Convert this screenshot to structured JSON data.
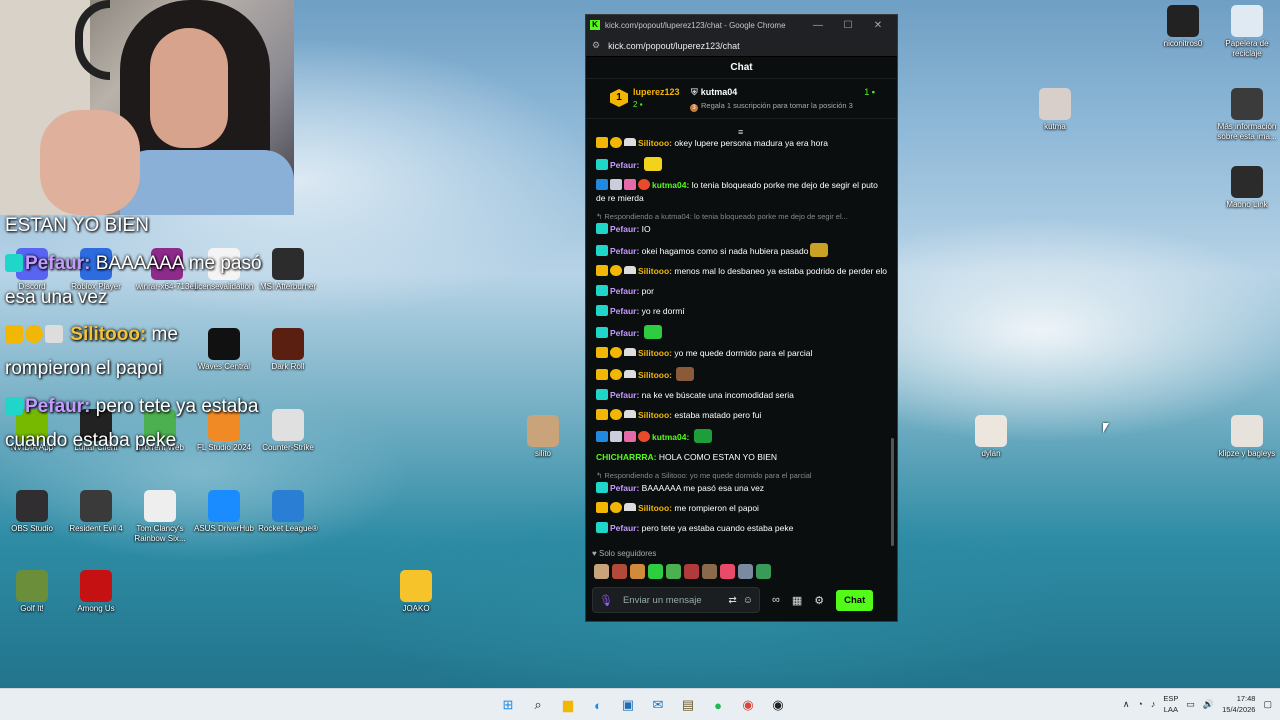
{
  "overlay": {
    "status": "ESTAN YO BIEN",
    "line1_user": "Pefaur:",
    "line1_text": "BAAAAAA me pasó",
    "line1_cont": "esa una vez",
    "line2_user": "Silitooo:",
    "line2_text": "me",
    "line2_cont": "rompieron el papoi",
    "line3_user": "Pefaur:",
    "line3_text": "pero tete ya estaba",
    "line3_cont": "cuando estaba peke"
  },
  "desktop_icons": [
    {
      "label": "Discord",
      "color": "#5865f2",
      "icon": "discord-icon"
    },
    {
      "label": "Roblox Player",
      "color": "#2d6cdf",
      "icon": "roblox-icon"
    },
    {
      "label": "winrar-x64-713es",
      "color": "#8e2a8a",
      "icon": "winrar-icon"
    },
    {
      "label": "licensevalidation",
      "color": "#f4f4f4",
      "icon": "file-icon"
    },
    {
      "label": "MSI Afterburner",
      "color": "#2c2c2c",
      "icon": "afterburner-icon"
    },
    {
      "label": "Waves Central",
      "color": "#111111",
      "icon": "waves-icon"
    },
    {
      "label": "Dark Roll",
      "color": "#5a1f10",
      "icon": "darkroll-icon"
    },
    {
      "label": "NVIDIA App",
      "color": "#76b900",
      "icon": "nvidia-icon"
    },
    {
      "label": "Lunar Client",
      "color": "#222222",
      "icon": "lunar-icon"
    },
    {
      "label": "uTorrent Web",
      "color": "#4caf50",
      "icon": "utorrent-icon"
    },
    {
      "label": "FL Studio 2024",
      "color": "#f08a24",
      "icon": "flstudio-icon"
    },
    {
      "label": "Counter-Strike",
      "color": "#e0e0e0",
      "icon": "counterstrike-icon"
    },
    {
      "label": "OBS Studio",
      "color": "#302e31",
      "icon": "obs-icon"
    },
    {
      "label": "Resident Evil 4",
      "color": "#3a3a3a",
      "icon": "re4-icon"
    },
    {
      "label": "Tom Clancy's Rainbow Six...",
      "color": "#eeeeee",
      "icon": "r6-icon"
    },
    {
      "label": "ASUS DriverHub",
      "color": "#1a8cff",
      "icon": "asus-icon"
    },
    {
      "label": "Rocket League®",
      "color": "#2a7fd4",
      "icon": "rocketleague-icon"
    },
    {
      "label": "Golf It!",
      "color": "#6b8e3a",
      "icon": "golfit-icon"
    },
    {
      "label": "Among Us",
      "color": "#c51111",
      "icon": "amongus-icon"
    },
    {
      "label": "JOAKO",
      "color": "#f6c32a",
      "icon": "joako-icon"
    },
    {
      "label": "silito",
      "color": "#c9a37a",
      "icon": "silito-icon"
    },
    {
      "label": "niconitros0",
      "color": "#222222",
      "icon": "niconitros-icon"
    },
    {
      "label": "Papelera de reciclaje",
      "color": "#dfeaf3",
      "icon": "recycle-bin-icon"
    },
    {
      "label": "kutma",
      "color": "#d8cfcb",
      "icon": "kutma-icon"
    },
    {
      "label": "Más información sobre esta ima...",
      "color": "#3b3b3b",
      "icon": "info-icon"
    },
    {
      "label": "Maono Link",
      "color": "#2b2b2b",
      "icon": "maono-icon"
    },
    {
      "label": "dylan",
      "color": "#ece6df",
      "icon": "dylan-icon"
    },
    {
      "label": "klipze y bagleys",
      "color": "#e7e2dc",
      "icon": "klipze-icon"
    }
  ],
  "window": {
    "title": "kick.com/popout/luperez123/chat - Google Chrome",
    "url": "kick.com/popout/luperez123/chat",
    "minimize": "—",
    "maximize": "☐",
    "close": "✕"
  },
  "chat": {
    "header": "Chat",
    "leaderboard": {
      "rank1": "1",
      "user1": "luperez123",
      "count1": "2",
      "user2": "kutma04",
      "count2": "1",
      "gift_rank": "3",
      "gift_text": "Regala 1 suscripción para tomar la posición 3"
    },
    "messages": [
      {
        "user": "Silitooo:",
        "color": "#f2b705",
        "badges": [
          "crown",
          "sub",
          "hat"
        ],
        "text": "okey lupere persona madura ya era hora"
      },
      {
        "user": "Pefaur:",
        "color": "#c59bff",
        "badges": [
          "kick"
        ],
        "text": "",
        "emote": "#f2d21b"
      },
      {
        "user": "kutma04:",
        "color": "#53fc18",
        "badges": [
          "blue",
          "white",
          "pink",
          "red"
        ],
        "text": "lo tenia bloqueado porke me dejo de segir el puto de re mierda"
      },
      {
        "reply": "Respondiendo a kutma04: lo tenia bloqueado porke me dejo de segir el...",
        "user": "Pefaur:",
        "color": "#c59bff",
        "badges": [
          "kick"
        ],
        "text": "IO"
      },
      {
        "user": "Pefaur:",
        "color": "#c59bff",
        "badges": [
          "kick"
        ],
        "text": "okei hagamos como si nada hubiera pasado",
        "emote": "#c9a125"
      },
      {
        "user": "Silitooo:",
        "color": "#f2b705",
        "badges": [
          "crown",
          "sub",
          "hat"
        ],
        "text": "menos mal lo desbaneo ya estaba podrido de perder elo"
      },
      {
        "user": "Pefaur:",
        "color": "#c59bff",
        "badges": [
          "kick"
        ],
        "text": "por"
      },
      {
        "user": "Pefaur:",
        "color": "#c59bff",
        "badges": [
          "kick"
        ],
        "text": "yo re dormí"
      },
      {
        "user": "Pefaur:",
        "color": "#c59bff",
        "badges": [
          "kick"
        ],
        "text": "",
        "emote": "#2ecc40"
      },
      {
        "user": "Silitooo:",
        "color": "#f2b705",
        "badges": [
          "crown",
          "sub",
          "hat"
        ],
        "text": "yo me quede dormido para el parcial"
      },
      {
        "user": "Silitooo:",
        "color": "#f2b705",
        "badges": [
          "crown",
          "sub",
          "hat"
        ],
        "text": "",
        "emote": "#8a5a3a"
      },
      {
        "user": "Pefaur:",
        "color": "#c59bff",
        "badges": [
          "kick"
        ],
        "text": "na ke ve búscate una incomodidad seria"
      },
      {
        "user": "Silitooo:",
        "color": "#f2b705",
        "badges": [
          "crown",
          "sub",
          "hat"
        ],
        "text": "estaba matado pero fui"
      },
      {
        "user": "kutma04:",
        "color": "#53fc18",
        "badges": [
          "blue",
          "white",
          "pink",
          "red"
        ],
        "text": "",
        "emote": "#1e9e3a"
      },
      {
        "user": "CHICHARRRA:",
        "color": "#53fc18",
        "badges": [],
        "text": "HOLA COMO ESTAN YO BIEN"
      },
      {
        "reply": "Respondiendo a Silitooo: yo me quede dormido para el parcial",
        "user": "Pefaur:",
        "color": "#c59bff",
        "badges": [
          "kick"
        ],
        "text": "BAAAAAA me pasó esa una vez"
      },
      {
        "user": "Silitooo:",
        "color": "#f2b705",
        "badges": [
          "crown",
          "sub",
          "hat"
        ],
        "text": "me rompieron el papoi"
      },
      {
        "user": "Pefaur:",
        "color": "#c59bff",
        "badges": [
          "kick"
        ],
        "text": "pero tete ya estaba cuando estaba peke"
      }
    ],
    "followers_only": "Solo seguidores",
    "emote_bar": [
      "#c9a37a",
      "#b24a3a",
      "#d08a3a",
      "#2ecc40",
      "#4caf50",
      "#b23a3a",
      "#8a6a4a",
      "#e84a6a",
      "#7a8aa0",
      "#3a9a5a"
    ],
    "input_placeholder": "Enviar un mensaje",
    "send_label": "Chat"
  },
  "taskbar": {
    "apps": [
      {
        "icon": "windows-start-icon",
        "glyph": "⊞",
        "color": "#1f8ae0"
      },
      {
        "icon": "search-icon",
        "glyph": "⌕",
        "color": "#222222"
      },
      {
        "icon": "file-explorer-icon",
        "glyph": "▆",
        "color": "#f2b705"
      },
      {
        "icon": "edge-icon",
        "glyph": "◐",
        "color": "#1f8ae0"
      },
      {
        "icon": "store-icon",
        "glyph": "▣",
        "color": "#1f6fb5"
      },
      {
        "icon": "outlook-icon",
        "glyph": "✉",
        "color": "#1f6fb5"
      },
      {
        "icon": "game-icon",
        "glyph": "▤",
        "color": "#6b5a2a"
      },
      {
        "icon": "spotify-icon",
        "glyph": "●",
        "color": "#1db954"
      },
      {
        "icon": "chrome-icon",
        "glyph": "◉",
        "color": "#db4437"
      },
      {
        "icon": "app-icon",
        "glyph": "◉",
        "color": "#222222"
      }
    ],
    "lang_top": "ESP",
    "lang_bottom": "LAA",
    "time": "17:48",
    "date": "15/4/2026"
  }
}
